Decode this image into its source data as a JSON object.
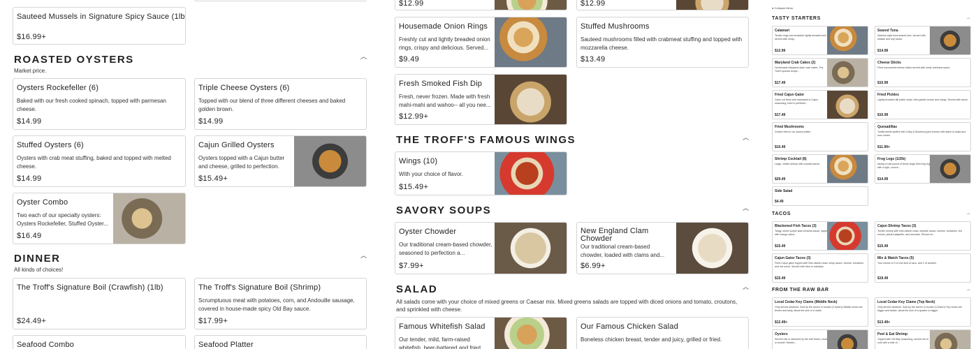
{
  "col1": {
    "mussels": {
      "name": "Sauteed Mussels in Signature Spicy Sauce (1lb)",
      "price": "$16.99+"
    },
    "roasted": {
      "title": "ROASTED OYSTERS",
      "subtitle": "Market price."
    },
    "rockefeller": {
      "name": "Oysters Rockefeller (6)",
      "desc": "Baked with our fresh cooked spinach, topped with parmesan cheese.",
      "price": "$14.99"
    },
    "triple": {
      "name": "Triple Cheese Oysters (6)",
      "desc": "Topped with our blend of three different cheeses and baked golden brown.",
      "price": "$14.99"
    },
    "stuffed": {
      "name": "Stuffed Oysters (6)",
      "desc": "Oysters with crab meat stuffing, baked and topped with melted cheese.",
      "price": "$14.99"
    },
    "grilled": {
      "name": "Cajun Grilled Oysters",
      "desc": "Oysters topped with a Cajun butter and cheese, grilled to perfection.",
      "price": "$15.49+"
    },
    "combo": {
      "name": "Oyster Combo",
      "desc": "Two each of our specialty oysters: Oysters Rockefeller, Stuffed Oyster...",
      "price": "$16.49"
    },
    "dinner": {
      "title": "DINNER",
      "subtitle": "All kinds of choices!"
    },
    "crawfish": {
      "name": "The Troff's Signature Boil (Crawfish) (1lb)",
      "price": "$24.49+"
    },
    "shrimpboil": {
      "name": "The Troff's Signature Boil (Shrimp)",
      "desc": "Scrumptuous meat with potatoes, corn, and Andouille sausage, covered in house-made spicy Old Bay sauce.",
      "price": "$17.99+"
    },
    "seafoodcombo": {
      "name": "Seafood Combo"
    },
    "seafoodplatter": {
      "name": "Seafood Platter"
    }
  },
  "col2": {
    "topleftprice": "$12.99",
    "toprightprice": "$12.99",
    "rings": {
      "name": "Housemade Onion Rings",
      "desc": "Freshly cut and lightly breaded onion rings, crispy and delicious. Served...",
      "price": "$9.49"
    },
    "mushrooms": {
      "name": "Stuffed Mushrooms",
      "desc": "Sauteed mushrooms filled with crabmeat stuffing and topped with mozzarella cheese.",
      "price": "$13.49"
    },
    "dip": {
      "name": "Fresh Smoked Fish Dip",
      "desc": "Fresh, never frozen. Made with fresh mahi-mahi and wahoo-- all you nee...",
      "price": "$12.99+"
    },
    "wingssec": {
      "title": "THE TROFF'S FAMOUS WINGS"
    },
    "wings": {
      "name": "Wings (10)",
      "desc": "With your choice of flavor.",
      "price": "$15.49+"
    },
    "soupsec": {
      "title": "SAVORY SOUPS"
    },
    "chowder": {
      "name": "Oyster Chowder",
      "desc": "Our traditional cream-based chowder, seasoned to perfection a...",
      "price": "$7.99+"
    },
    "clam": {
      "name": "New England Clam Chowder",
      "desc": "Our traditional cream-based chowder, loaded with clams and...",
      "price": "$6.99+"
    },
    "saladsec": {
      "title": "SALAD",
      "subtitle": "All salads come with your choice of mixed greens or Caesar mix. Mixed greens salads are topped with diced onions and tomato, croutons, and sprinkled with cheese."
    },
    "whitefish": {
      "name": "Famous Whitefish Salad",
      "desc": "Our tender, mild, farm-raised whitefish, beer-battered and fried,..."
    },
    "chicken": {
      "name": "Our Famous Chicken Salad",
      "desc": "Boneless chicken breast, tender and juicy, grilled or fried."
    }
  },
  "col3": {
    "collapse": "Collapse Menu",
    "starters": "TASTY STARTERS",
    "tacos": "TACOS",
    "rawbar": "FROM THE RAW BAR",
    "items": [
      {
        "name": "Calamari",
        "desc": "Tender rings and tentacles lightly breaded and served with zesty...",
        "price": "$12.99"
      },
      {
        "name": "Seared Tuna",
        "desc": "Sashimi-style tuna seared rare, served with wasabi and soy sauce.",
        "price": "$14.99"
      },
      {
        "name": "Maryland Crab Cakes (2)",
        "desc": "Homemade Maryland-style crab cakes. The Troff's special recipe...",
        "price": "$17.49"
      },
      {
        "name": "Cheese Sticks",
        "desc": "Fried mozzarella cheese sticks served with zesty marinara sauce.",
        "price": "$10.99"
      },
      {
        "name": "Fried Cajun Gator",
        "desc": "Gator cut fresh and marinated in Cajun seasoning, fried to perfectio...",
        "price": "$17.49"
      },
      {
        "name": "Fried Pickles",
        "desc": "Lightly breaded dill pickle chips, fried golden brown and crispy. Served with ranch.",
        "price": "$10.99"
      },
      {
        "name": "Fried Mushrooms",
        "desc": "Golden fried in our savory batter.",
        "price": "$10.49"
      },
      {
        "name": "Quesadillas",
        "desc": "Tortilla shells stuffed with Colby & Monterey jack cheese with sides of salsa and sour cream.",
        "price": "$11.99+"
      },
      {
        "name": "Shrimp Cocktail (8)",
        "desc": "Large, chilled shrimp with cocktail sauce.",
        "price": "$29.49"
      },
      {
        "name": "Frog Legs (1/2lb)",
        "desc": "Nearly a half pound of these large fried frog legs, with a light, crunch...",
        "price": "$14.99"
      },
      {
        "name": "Side Salad",
        "desc": "",
        "price": "$4.49"
      },
      {
        "name": "Blackened Fish Tacos (3)",
        "desc": "Tangy, sweet purple slaw sriracha sauce, topped with mango salsa...",
        "price": "$15.49"
      },
      {
        "name": "Cajun Shrimp Tacos (3)",
        "desc": "Tender shrimp with lime-cilantro slaw, chipotle sauce, cheese, tomatoes, red onions, pickled jalapeño, and avocado. Served wi...",
        "price": "$15.49"
      },
      {
        "name": "Cajun Gator Tacos (3)",
        "desc": "Fried Cajun gator topped with lime-cilantro slaw, zesty sauce, cheese, tomatoes, and red onion. Served with fries or coleslaw.",
        "price": "$15.49"
      },
      {
        "name": "Mix & Match Tacos (5)",
        "desc": "Your choice of 3 of one kind of taco, and 2 of another.",
        "price": "$19.49"
      },
      {
        "name": "Local Cedar Key Clams (Middle Neck)",
        "desc": "Only served steamed. Sold by the dozen or bucket (3 dozen)! Middle necks are tender and tasty, about the size of a nickle.",
        "price": "$12.49+"
      },
      {
        "name": "Local Cedar Key Clams (Top Neck)",
        "desc": "Only served steamed. Sold by the dozen or bucket (3 dozen)! Top necks are bigger and tastier, about the size of a quarter or bigger.",
        "price": "$13.49+"
      },
      {
        "name": "Oysters",
        "desc": "Served raw or steamed by the half dozen, dozen, or bucket. Market...",
        "price": ""
      },
      {
        "name": "Peel & Eat Shrimp",
        "desc": "Topped with Old Bay seasoning, served hot or cold with a side of...",
        "price": ""
      }
    ]
  }
}
